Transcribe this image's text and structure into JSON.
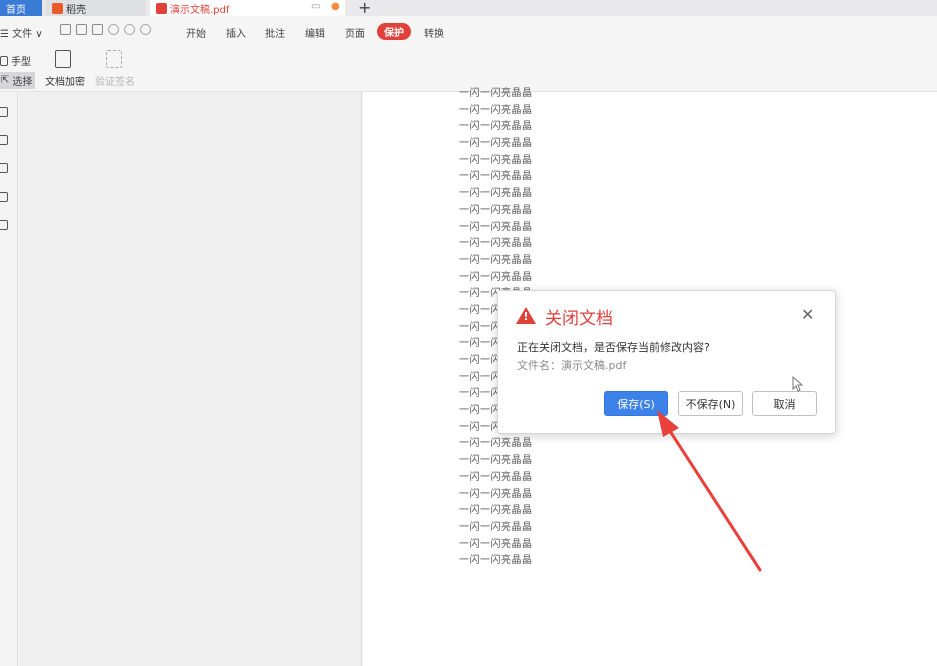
{
  "tabs": {
    "home": "首页",
    "daoke": "稻壳",
    "document": "演示文稿.pdf"
  },
  "menu": {
    "file": "☰ 文件 ∨",
    "items": [
      "开始",
      "插入",
      "批注",
      "编辑",
      "页面",
      "保护",
      "转换"
    ],
    "active": "保护"
  },
  "ribbon": {
    "hand": "手型",
    "select": "选择",
    "encrypt": "文档加密",
    "verify_sign": "验证签名"
  },
  "document": {
    "line_text": "一闪一闪亮晶晶",
    "line_count": 29
  },
  "dialog": {
    "title": "关闭文档",
    "message": "正在关闭文档，是否保存当前修改内容?",
    "file_label": "文件名：演示文稿.pdf",
    "save": "保存(S)",
    "dont_save": "不保存(N)",
    "cancel": "取消",
    "close": "✕"
  },
  "colors": {
    "accent": "#e0413a",
    "primary": "#3d82e8",
    "annotation_arrow": "#e8403a"
  }
}
